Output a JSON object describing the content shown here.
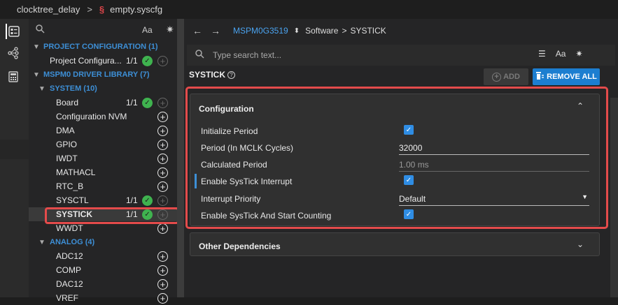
{
  "breadcrumb": {
    "project": "clocktree_delay",
    "separator": ">",
    "file": "empty.syscfg"
  },
  "sidebar": {
    "search_placeholder": "",
    "case_toggle": "Aa",
    "sections": {
      "project_config": "PROJECT CONFIGURATION (1)",
      "driver_lib": "MSPM0 DRIVER LIBRARY (7)",
      "system": "SYSTEM (10)",
      "analog": "ANALOG (4)"
    },
    "project_item": {
      "label": "Project Configura...",
      "count": "1/1"
    },
    "system_items": [
      {
        "label": "Board",
        "count": "1/1"
      },
      {
        "label": "Configuration NVM",
        "count": ""
      },
      {
        "label": "DMA",
        "count": ""
      },
      {
        "label": "GPIO",
        "count": ""
      },
      {
        "label": "IWDT",
        "count": ""
      },
      {
        "label": "MATHACL",
        "count": ""
      },
      {
        "label": "RTC_B",
        "count": ""
      },
      {
        "label": "SYSCTL",
        "count": "1/1"
      },
      {
        "label": "SYSTICK",
        "count": "1/1"
      },
      {
        "label": "WWDT",
        "count": ""
      }
    ],
    "analog_items": [
      {
        "label": "ADC12"
      },
      {
        "label": "COMP"
      },
      {
        "label": "DAC12"
      },
      {
        "label": "VREF"
      }
    ]
  },
  "nav": {
    "device": "MSPM0G3519",
    "path1": "Software",
    "sep": ">",
    "path2": "SYSTICK"
  },
  "main": {
    "search_placeholder": "Type search text...",
    "case_toggle": "Aa",
    "module_title": "SYSTICK",
    "help": "?",
    "add_label": "ADD",
    "remove_label": "REMOVE ALL",
    "config_title": "Configuration",
    "other_title": "Other Dependencies",
    "props": {
      "init_period": "Initialize Period",
      "period": "Period (In MCLK Cycles)",
      "period_value": "32000",
      "calc_period": "Calculated Period",
      "calc_value": "1.00 ms",
      "enable_int": "Enable SysTick Interrupt",
      "int_priority": "Interrupt Priority",
      "int_priority_value": "Default",
      "enable_start": "Enable SysTick And Start Counting"
    }
  }
}
